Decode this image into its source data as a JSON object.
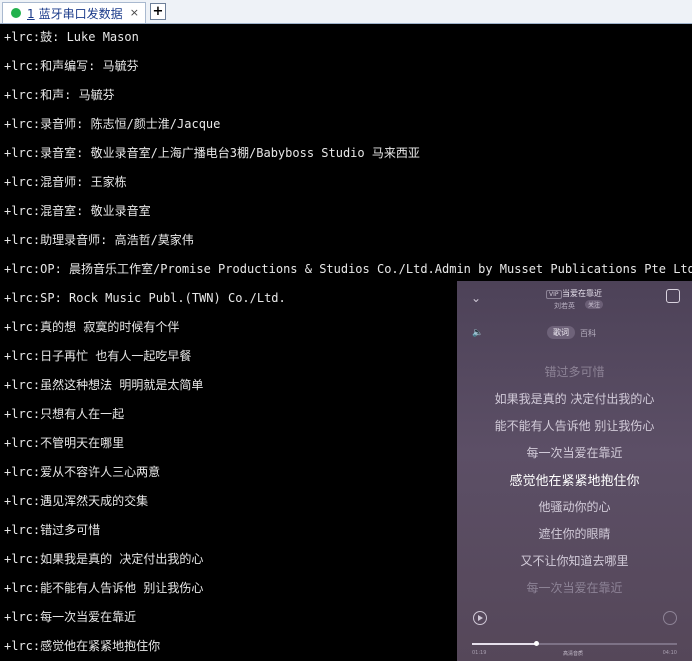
{
  "tab": {
    "number": "1",
    "title": "蓝牙串口发数据",
    "close": "×",
    "add": "+"
  },
  "terminal": {
    "lines": [
      "+lrc:鼓: Luke Mason",
      "+lrc:和声编写: 马毓芬",
      "+lrc:和声: 马毓芬",
      "+lrc:录音师: 陈志恒/颜士淮/Jacque",
      "+lrc:录音室: 敬业录音室/上海广播电台3棚/Babyboss Studio 马来西亚",
      "+lrc:混音师: 王家栋",
      "+lrc:混音室: 敬业录音室",
      "+lrc:助理录音师: 高浩哲/莫家伟",
      "+lrc:OP: 晨扬音乐工作室/Promise Productions & Studios Co./Ltd.Admin by Musset Publications Pte Ltd",
      "+lrc:SP: Rock Music Publ.(TWN) Co./Ltd.",
      "+lrc:真的想 寂寞的时候有个伴",
      "+lrc:日子再忙 也有人一起吃早餐",
      "+lrc:虽然这种想法 明明就是太简单",
      "+lrc:只想有人在一起",
      "+lrc:不管明天在哪里",
      "+lrc:爱从不容许人三心两意",
      "+lrc:遇见浑然天成的交集",
      "+lrc:错过多可惜",
      "+lrc:如果我是真的 决定付出我的心",
      "+lrc:能不能有人告诉他 别让我伤心",
      "+lrc:每一次当爱在靠近",
      "+lrc:感觉他在紧紧地抱住你"
    ]
  },
  "player": {
    "vip": "VIP",
    "song_title": "当爱在靠近",
    "artist": "刘若英",
    "follow": "关注",
    "tabs": [
      "歌词",
      "百科"
    ],
    "lyrics": [
      "错过多可惜",
      "如果我是真的 决定付出我的心",
      "能不能有人告诉他 别让我伤心",
      "每一次当爱在靠近",
      "感觉他在紧紧地抱住你",
      "他骚动你的心",
      "遮住你的眼睛",
      "又不让你知道去哪里",
      "每一次当爱在靠近"
    ],
    "active_lyric_index": 4,
    "progress": 0.31,
    "time_elapsed": "01:19",
    "quality": "高清音质",
    "time_total": "04:10"
  }
}
